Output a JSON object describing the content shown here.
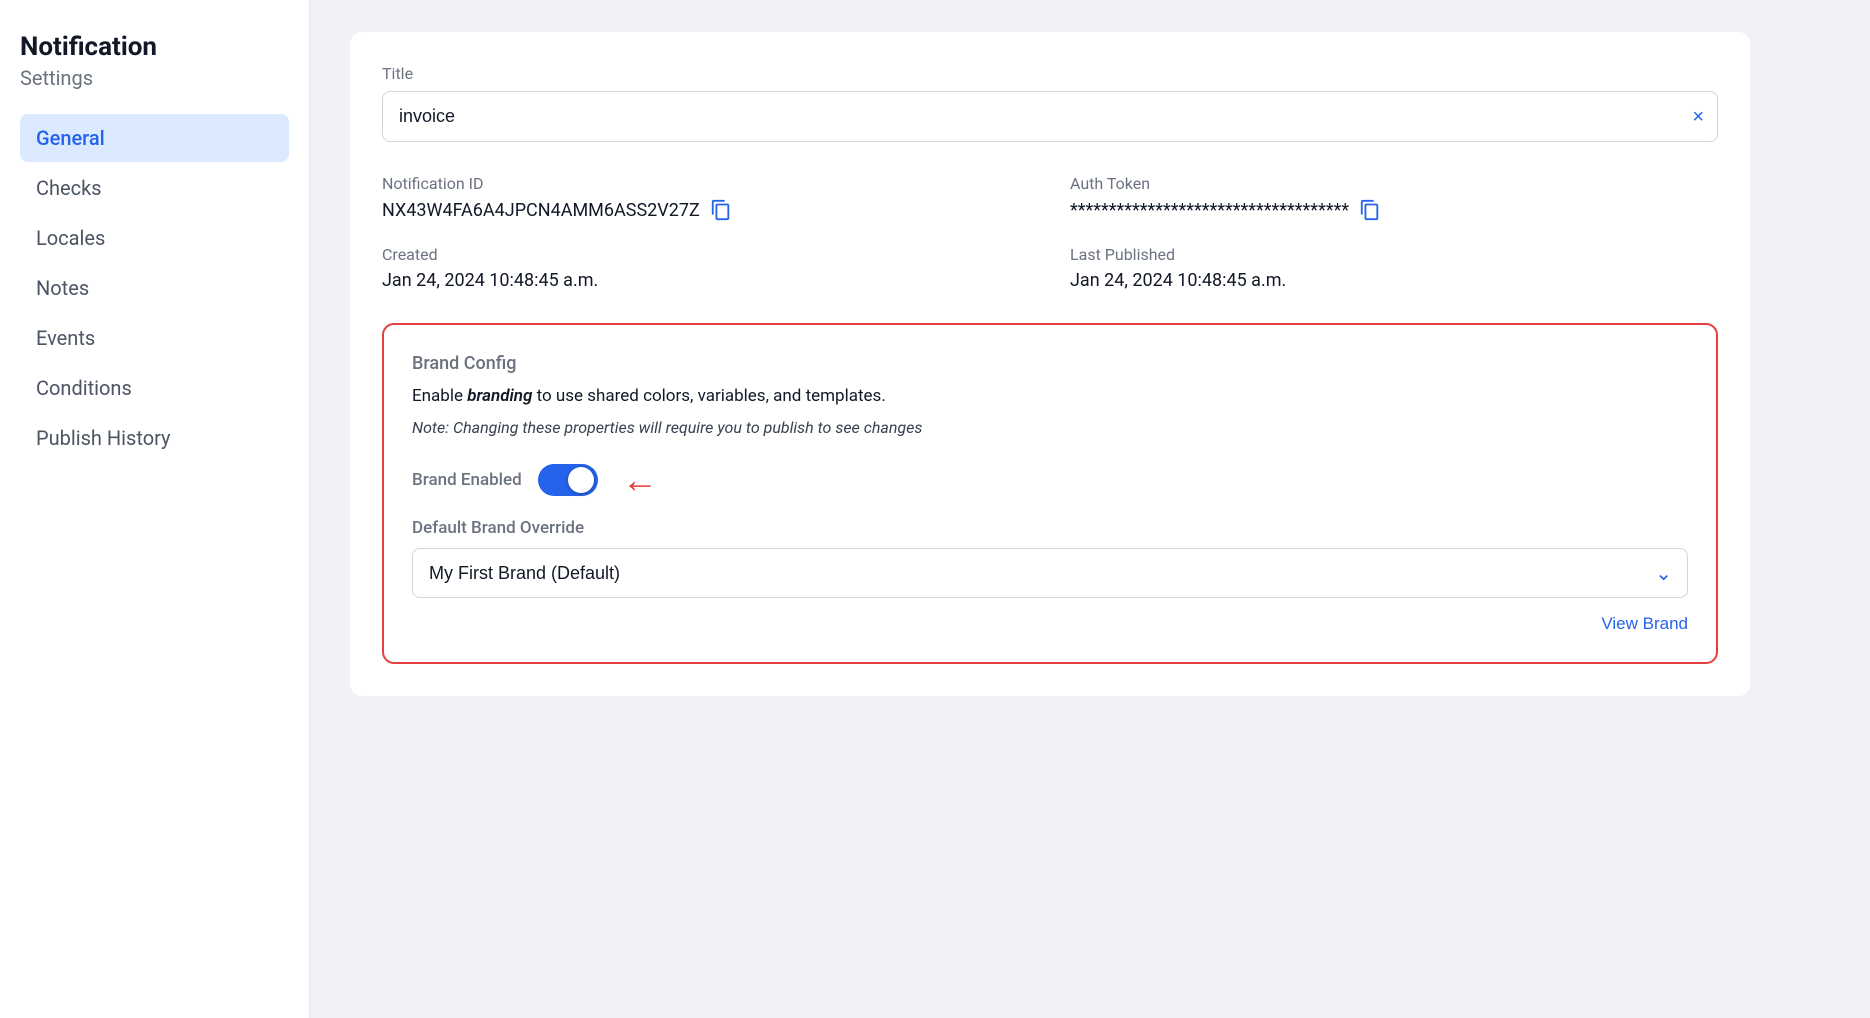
{
  "sidebar": {
    "title": "Notification",
    "subtitle": "Settings",
    "items": [
      {
        "id": "general",
        "label": "General",
        "active": true
      },
      {
        "id": "checks",
        "label": "Checks",
        "active": false
      },
      {
        "id": "locales",
        "label": "Locales",
        "active": false
      },
      {
        "id": "notes",
        "label": "Notes",
        "active": false
      },
      {
        "id": "events",
        "label": "Events",
        "active": false
      },
      {
        "id": "conditions",
        "label": "Conditions",
        "active": false
      },
      {
        "id": "publish-history",
        "label": "Publish History",
        "active": false
      }
    ]
  },
  "main": {
    "title_label": "Title",
    "title_value": "invoice",
    "title_clear_label": "×",
    "notification_id_label": "Notification ID",
    "notification_id_value": "NX43W4FA6A4JPCN4AMM6ASS2V27Z",
    "auth_token_label": "Auth Token",
    "auth_token_value": "************************************",
    "created_label": "Created",
    "created_value": "Jan 24, 2024 10:48:45 a.m.",
    "last_published_label": "Last Published",
    "last_published_value": "Jan 24, 2024 10:48:45 a.m.",
    "brand_config": {
      "title": "Brand Config",
      "description_prefix": "Enable ",
      "description_italic": "branding",
      "description_suffix": " to use shared colors, variables, and templates.",
      "note": "Note: Changing these properties will require you to publish to see changes",
      "brand_enabled_label": "Brand Enabled",
      "brand_enabled": true,
      "default_brand_label": "Default Brand Override",
      "brand_options": [
        {
          "value": "my-first-brand",
          "label": "My First Brand (Default)"
        }
      ],
      "selected_brand": "My First Brand (Default)",
      "view_brand_label": "View Brand"
    }
  }
}
